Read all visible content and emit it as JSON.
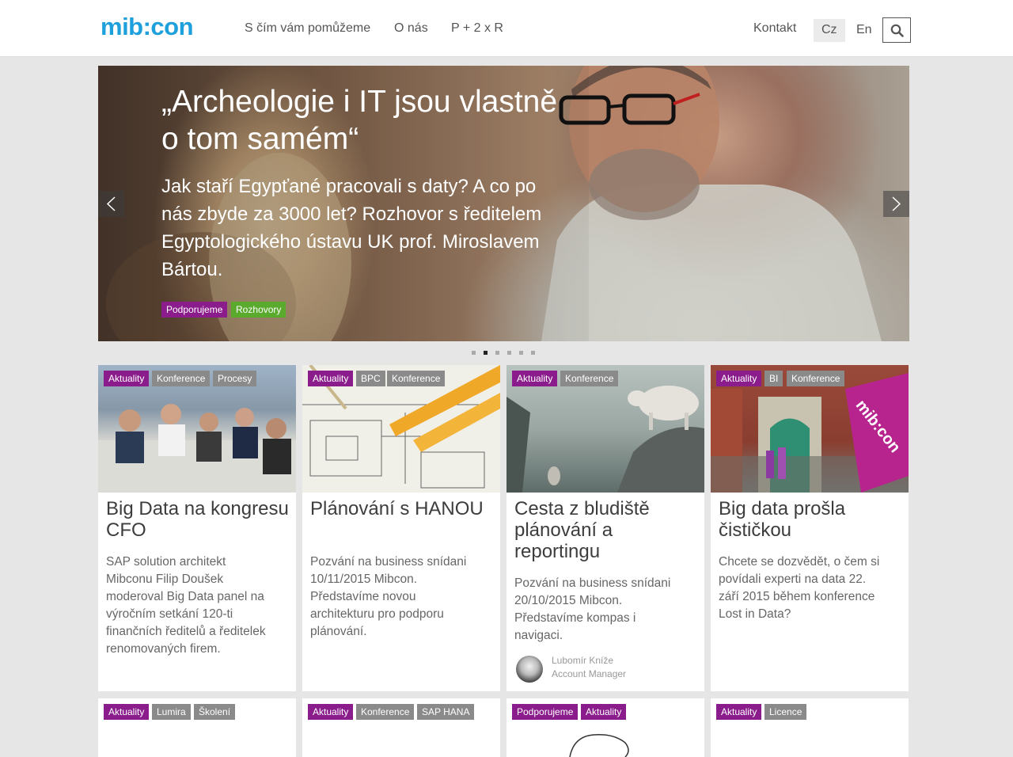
{
  "header": {
    "logo": "mib:con",
    "nav": [
      "S čím vám pomůžeme",
      "O nás",
      "P + 2 x R"
    ],
    "contact": "Kontakt",
    "lang_cz": "Cz",
    "lang_en": "En",
    "search_icon": "search-icon"
  },
  "hero": {
    "title": "„Archeologie i IT jsou vlastně  o tom samém“",
    "text": "Jak staří Egypťané pracovali s daty? A co po nás zbyde za 3000 let? Rozhovor s ředitelem Egyptologického ústavu UK prof. Miroslavem Bártou.",
    "tags": [
      "Podporujeme",
      "Rozhovory"
    ],
    "tag_colors": [
      "#8a1c8c",
      "#5aaa2e"
    ],
    "prev_icon": "chevron-left-icon",
    "next_icon": "chevron-right-icon",
    "slides": 6,
    "active_slide": 2
  },
  "cards": [
    {
      "tags": [
        "Aktuality",
        "Konference",
        "Procesy"
      ],
      "title": "Big Data na kongresu CFO",
      "text": "SAP solution architekt Mibconu Filip Doušek moderoval Big Data panel na výročním setkání 120-ti finančních ředitelů a ředitelek renomovaných firem."
    },
    {
      "tags": [
        "Aktuality",
        "BPC",
        "Konference"
      ],
      "title": "Plánování s HANOU",
      "text": "Pozvání na business snídani 10/11/2015 Mibcon. Představíme novou architekturu pro podporu plánování."
    },
    {
      "tags": [
        "Aktuality",
        "Konference"
      ],
      "title": "Cesta z bludiště plánování a reportingu",
      "text": "Pozvání na business snídani 20/10/2015 Mibcon. Představíme kompas i navigaci.",
      "author_name": "Lubomír Kníže",
      "author_role": "Account Manager"
    },
    {
      "tags": [
        "Aktuality",
        "BI",
        "Konference"
      ],
      "title": "Big data prošla čističkou",
      "text": "Chcete se dozvědět, o čem si povídali experti na data 22. září 2015 během konference Lost in Data?",
      "banner_text": "mib:con"
    }
  ],
  "cards_row2": [
    {
      "tags": [
        "Aktuality",
        "Lumira",
        "Školení"
      ]
    },
    {
      "tags": [
        "Aktuality",
        "Konference",
        "SAP HANA"
      ]
    },
    {
      "tags": [
        "Podporujeme",
        "Aktuality"
      ]
    },
    {
      "tags": [
        "Aktuality",
        "Licence"
      ]
    }
  ]
}
